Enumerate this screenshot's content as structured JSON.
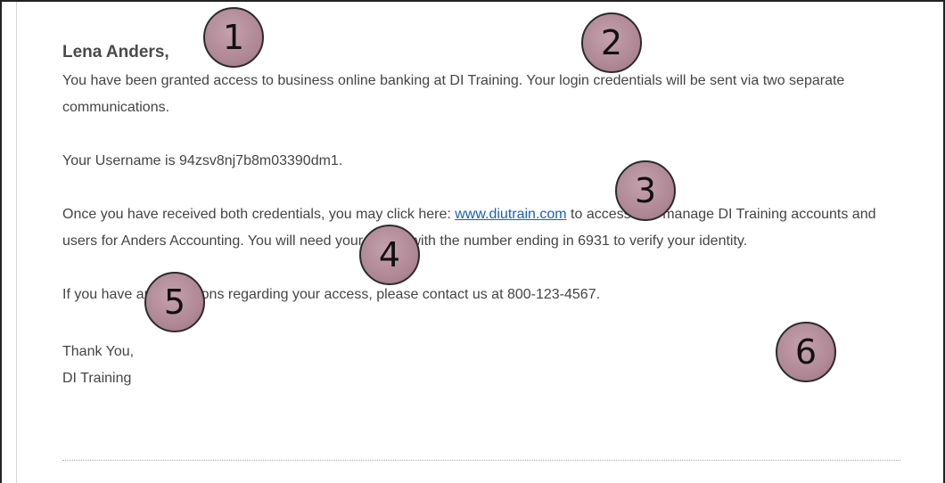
{
  "email": {
    "greeting": "Lena Anders,",
    "para1": "You have been granted access to business online banking at DI Training. Your login credentials will be sent via two separate communications.",
    "para2": "Your Username is 94zsv8nj7b8m03390dm1.",
    "para3_before": "Once you have received both credentials, you may click here: ",
    "para3_link": "www.diutrain.com",
    "para3_after": " to access and manage DI Training accounts and users for Anders Accounting. You will need your phone with the number ending in 6931 to verify your identity.",
    "para4": "If you have any questions regarding your access, please contact us at 800-123-4567.",
    "closing": "Thank You,",
    "signature": "DI Training"
  },
  "callouts": [
    "1",
    "2",
    "3",
    "4",
    "5",
    "6"
  ]
}
